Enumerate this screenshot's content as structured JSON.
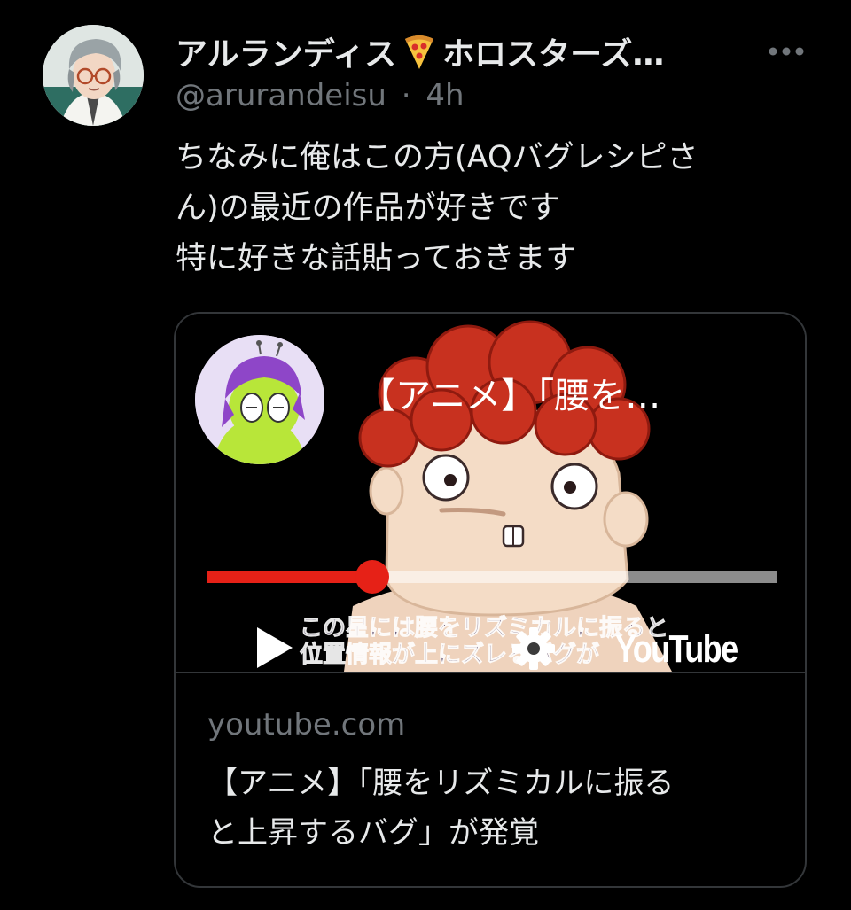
{
  "tweet": {
    "display_name": "アルランディス",
    "name_suffix": "ホロスターズ…",
    "handle": "@arurandeisu",
    "separator": "·",
    "time": "4h",
    "text_lines": [
      "ちなみに俺はこの方(AQバグレシピさ",
      "ん)の最近の作品が好きです",
      "特に好きな話貼っておきます"
    ]
  },
  "card": {
    "video_title": "【アニメ】「腰を…",
    "subtitle_lines": [
      "この星には腰をリズミカルに振ると",
      "位置情報が上にズレるバグが"
    ],
    "youtube_logo": "YouTube",
    "progress": 0.29,
    "domain": "youtube.com",
    "title_lines": [
      "【アニメ】「腰をリズミカルに振る",
      "と上昇するバグ」が発覚"
    ]
  },
  "colors": {
    "background": "#000000",
    "text_primary": "#e7e9ea",
    "text_secondary": "#71767b",
    "border": "#333639",
    "progress_red": "#e62117"
  },
  "icons": {
    "name_icon": "pizza-icon",
    "more": "more-dots-icon",
    "play": "play-icon",
    "settings": "gear-icon"
  }
}
